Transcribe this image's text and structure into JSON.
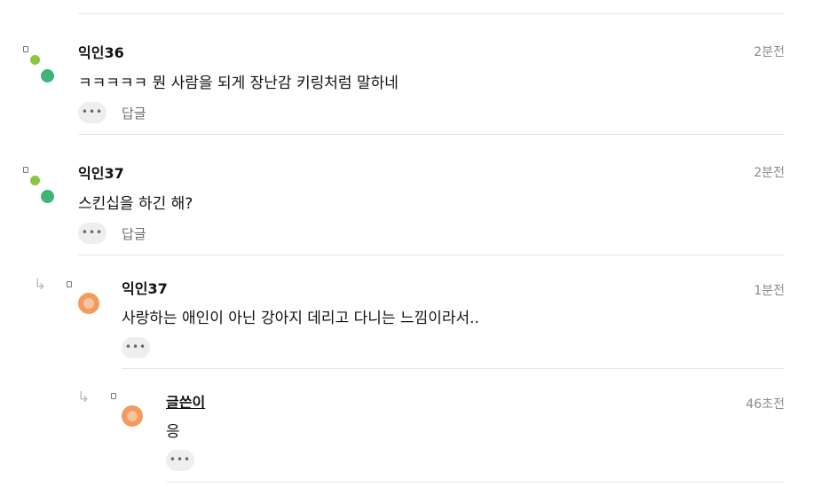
{
  "comments": [
    {
      "author": "익인36",
      "time": "2분전",
      "text": "ㅋㅋㅋㅋㅋ 뭔 사람을 되게 장난감 키링처럼 말하네",
      "more": "•••",
      "reply_label": "답글"
    },
    {
      "author": "익인37",
      "time": "2분전",
      "text": "스킨십을 하긴 해?",
      "more": "•••",
      "reply_label": "답글"
    },
    {
      "author": "익인37",
      "time": "1분전",
      "text": "사랑하는 애인이 아닌 강아지 데리고 다니는 느낌이라서..",
      "more": "•••"
    },
    {
      "author": "글쓴이",
      "time": "46초전",
      "text": "응",
      "more": "•••"
    }
  ],
  "icons": {
    "reply_arrow": "↳"
  },
  "colors": {
    "avatar_green_small": "#8cc63e",
    "avatar_green_large": "#3fb477",
    "avatar_orange": "#f39a5e"
  }
}
